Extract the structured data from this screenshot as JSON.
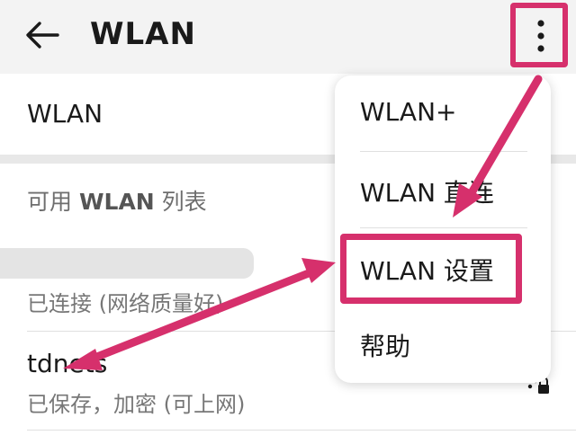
{
  "header": {
    "title": "WLAN",
    "back_icon": "arrow-left-icon",
    "more_icon": "more-vert-icon"
  },
  "wlan_toggle": {
    "label": "WLAN"
  },
  "available_list": {
    "section_prefix": "可用 ",
    "section_bold": "WLAN",
    "section_suffix": " 列表",
    "networks": [
      {
        "name": "",
        "status": "已连接 (网络质量好)"
      },
      {
        "name": "tdnets",
        "status": "已保存，加密 (可上网)",
        "icon": "lock-wifi-icon"
      }
    ]
  },
  "overflow_menu": {
    "items": [
      {
        "label": "WLAN+"
      },
      {
        "label": "WLAN 直连"
      },
      {
        "label": "WLAN 设置"
      },
      {
        "label": "帮助"
      }
    ]
  },
  "colors": {
    "highlight": "#d6306c",
    "accent_text": "#1a1a1a",
    "secondary_text": "#777777"
  }
}
